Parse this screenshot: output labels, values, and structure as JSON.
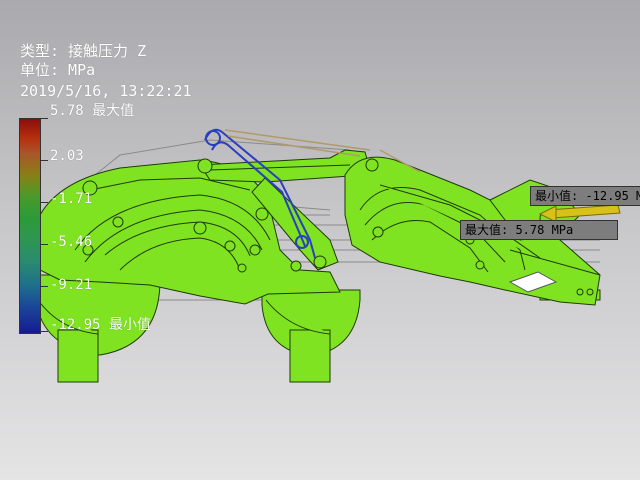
{
  "header": {
    "type_line": "类型: 接触压力 Z",
    "unit_line": "单位: MPa",
    "timestamp": "2019/5/16, 13:22:21"
  },
  "legend": {
    "max_label": "5.78 最大值",
    "ticks": [
      "2.03",
      "-1.71",
      "-5.46",
      "-9.21"
    ],
    "min_label": "-12.95 最小值"
  },
  "probes": {
    "min_probe": "最小值: -12.95 M",
    "max_probe": "最大值: 5.78 MPa"
  },
  "colors": {
    "model_fill": "#7fe322",
    "model_edge": "#1f3a08",
    "link_blue": "#2a3fbf",
    "arrow_yellow": "#d8c21a"
  }
}
